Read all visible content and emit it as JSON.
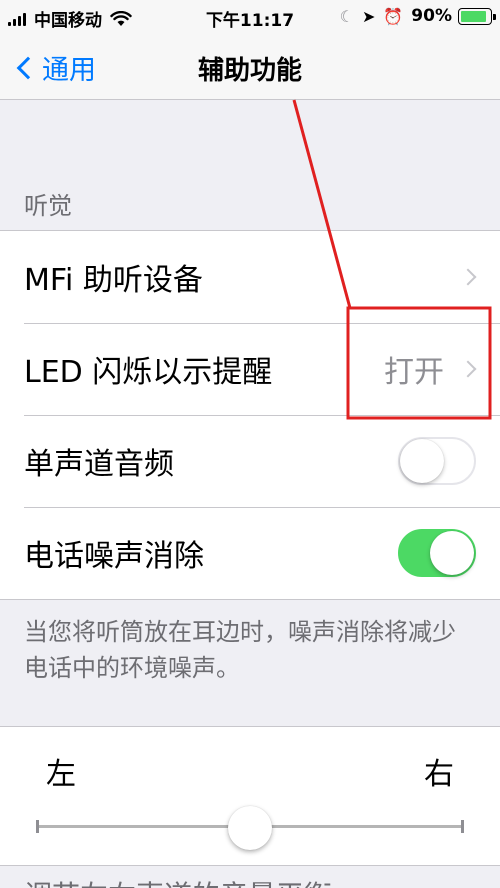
{
  "status_bar": {
    "carrier": "中国移动",
    "time": "下午11:17",
    "battery_percent": "90%",
    "battery_level": 0.9,
    "icons": [
      "signal-icon",
      "wifi-icon",
      "moon-icon",
      "location-icon",
      "alarm-icon",
      "battery-icon"
    ]
  },
  "nav": {
    "back_label": "通用",
    "title": "辅助功能"
  },
  "hearing": {
    "header": "听觉",
    "rows": [
      {
        "label": "MFi 助听设备",
        "value": ""
      },
      {
        "label": "LED 闪烁以示提醒",
        "value": "打开"
      },
      {
        "label": "单声道音频",
        "toggle": false
      },
      {
        "label": "电话噪声消除",
        "toggle": true
      }
    ],
    "footer": "当您将听筒放在耳边时，噪声消除将减少电话中的环境噪声。"
  },
  "balance": {
    "left_label": "左",
    "right_label": "右",
    "value": 0.5
  },
  "next_section_text": "调节左右声道的音量平衡",
  "colors": {
    "accent": "#007aff",
    "toggle_on": "#4cd964",
    "annotation": "#e02020"
  }
}
